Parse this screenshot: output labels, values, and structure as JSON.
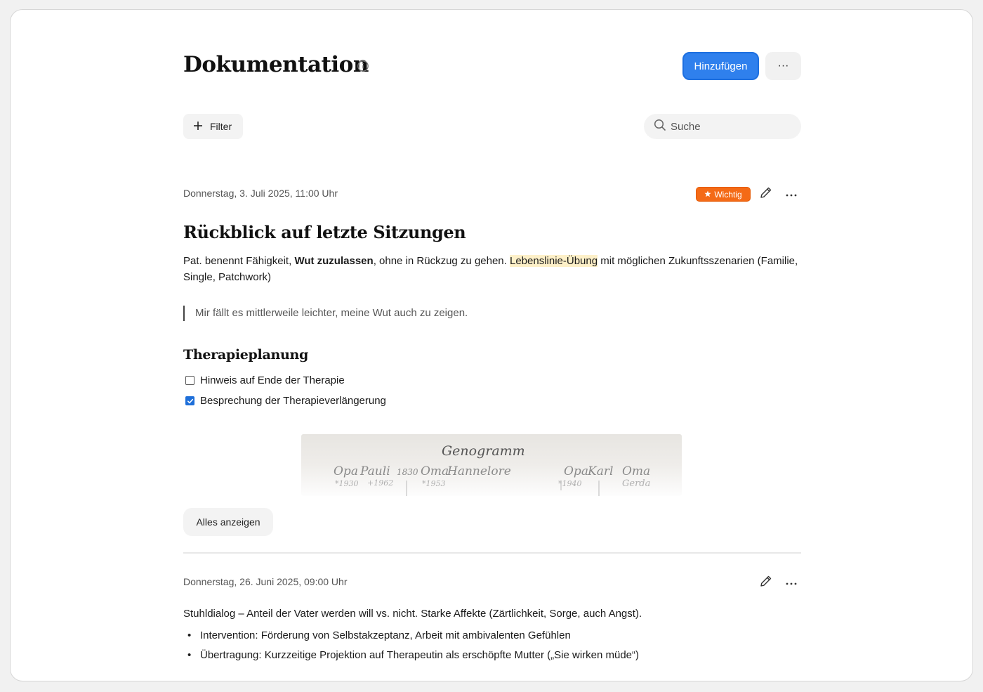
{
  "header": {
    "title": "Dokumentation",
    "add_label": "Hinzufügen",
    "more_label": "···"
  },
  "toolbar": {
    "filter_label": "Filter",
    "search_placeholder": "Suche"
  },
  "entries": [
    {
      "date": "Donnerstag, 3. Juli 2025, 11:00 Uhr",
      "badge": "Wichtig",
      "title": "Rückblick auf letzte Sitzungen",
      "para_a": "Pat. benennt Fähigkeit, ",
      "para_bold": "Wut zuzulassen",
      "para_b": ", ohne in Rückzug zu gehen. ",
      "para_highlight": "Lebenslinie-Übung",
      "para_c": " mit möglichen Zukunftsszenarien (Familie, Single, Patchwork)",
      "quote": "Mir fällt es mittlerweile leichter, meine Wut auch zu zeigen.",
      "section_heading": "Therapieplanung",
      "checklist": [
        {
          "label": "Hinweis auf Ende der Therapie",
          "checked": false
        },
        {
          "label": "Besprechung der Therapieverlängerung",
          "checked": true
        }
      ],
      "image": {
        "title": "Genogramm",
        "names": [
          "Opa",
          "Pauli",
          "1830",
          "Oma",
          "Hannelore",
          "Opa",
          "Karl",
          "Oma",
          "Gerda"
        ],
        "years": [
          "*1930",
          "+1962",
          "*1953",
          "*1940"
        ]
      },
      "show_all_label": "Alles anzeigen"
    },
    {
      "date": "Donnerstag, 26. Juni 2025, 09:00 Uhr",
      "text": "Stuhldialog – Anteil der Vater werden will vs. nicht. Starke Affekte (Zärtlichkeit, Sorge, auch Angst).",
      "bullets": [
        "Intervention: Förderung von Selbstakzeptanz, Arbeit mit ambivalenten Gefühlen",
        "Übertragung: Kurzzeitige Projektion auf Therapeutin als erschöpfte Mutter („Sie wirken müde“)"
      ]
    }
  ],
  "colors": {
    "accent": "#2f80ed",
    "badge": "#f46a16",
    "highlight": "#fdf0c8",
    "checkbox": "#1e6fd9"
  }
}
